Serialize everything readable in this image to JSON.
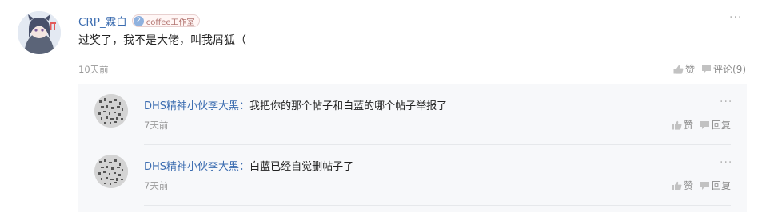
{
  "comment": {
    "author": "CRP_霖白",
    "badge": {
      "level": "2",
      "text": "coffee工作室"
    },
    "more": "···",
    "content": "过奖了，我不是大佬，叫我屑狐（",
    "time": "10天前",
    "like_label": "赞",
    "reply_label": "评论(9)"
  },
  "replies": [
    {
      "author": "DHS精神小伙李大黑",
      "colon": "：",
      "text": "我把你的那个帖子和白蓝的哪个帖子举报了",
      "time": "7天前",
      "like_label": "赞",
      "reply_label": "回复",
      "more": "···"
    },
    {
      "author": "DHS精神小伙李大黑",
      "colon": "：",
      "text": "白蓝已经自觉删帖子了",
      "time": "7天前",
      "like_label": "赞",
      "reply_label": "回复",
      "more": "···"
    }
  ],
  "icons": {
    "like": "thumbs-up-icon",
    "comment": "speech-bubble-icon",
    "more": "more-dots-icon"
  },
  "colors": {
    "link": "#3b6cb0",
    "muted": "#999999",
    "reply_bg": "#f7f8fa"
  }
}
